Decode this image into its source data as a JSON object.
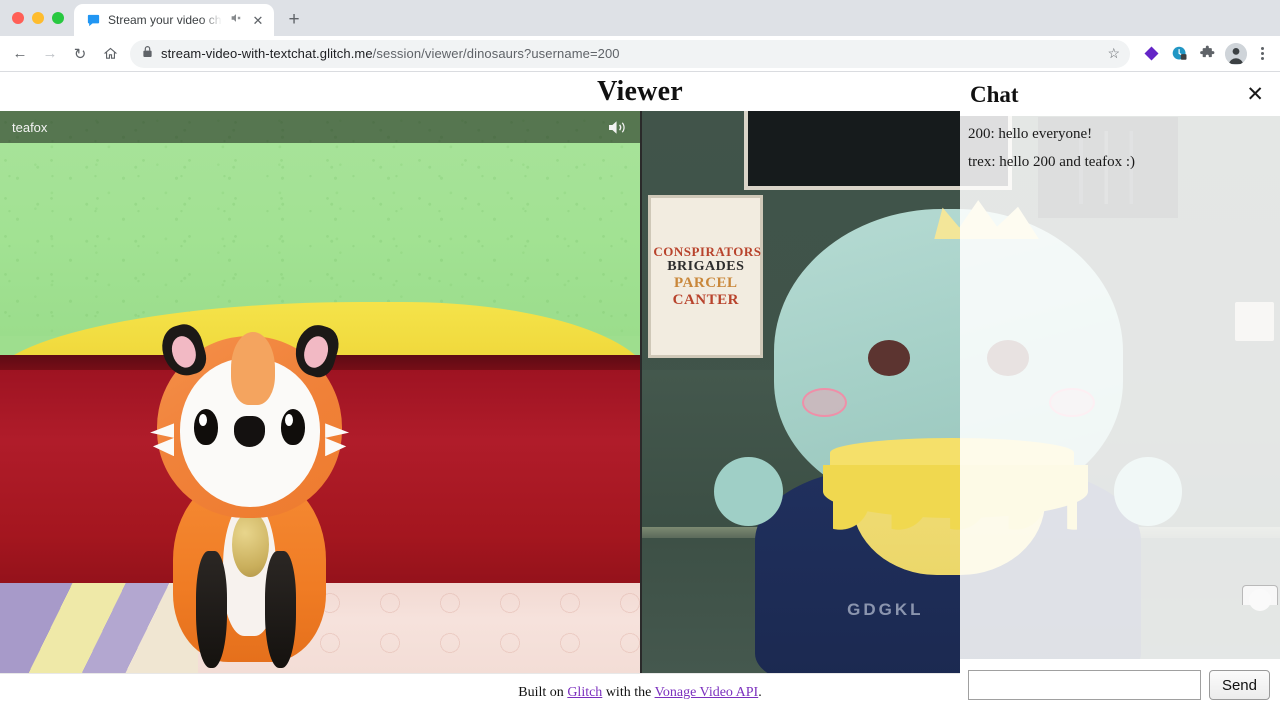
{
  "browser": {
    "tab": {
      "title": "Stream your video chat (en",
      "favicon_name": "glitch-favicon",
      "mute_icon": "speaker-muted-icon",
      "close_label": "✕"
    },
    "new_tab_label": "+",
    "nav": {
      "back_label": "←",
      "forward_label": "→",
      "reload_label": "↻",
      "home_label": "⌂"
    },
    "omnibox": {
      "lock_icon": "lock-icon",
      "host": "stream-video-with-textchat.glitch.me",
      "path": "/session/viewer/dinosaurs?username=200",
      "star_label": "☆"
    },
    "toolbar_icons": [
      {
        "name": "diamond-extension-icon",
        "color": "#6425c7"
      },
      {
        "name": "clock-privacy-icon",
        "color": "#2196c4"
      },
      {
        "name": "puzzle-extensions-icon",
        "color": "#5f6368"
      },
      {
        "name": "profile-avatar-icon",
        "color": "#3c4043"
      }
    ],
    "menu_label": "kebab-menu"
  },
  "page": {
    "title": "Viewer",
    "footer": {
      "prefix": "Built on ",
      "link1": "Glitch",
      "middle": " with the ",
      "link2": "Vonage Video API",
      "suffix": ".",
      "link_color": "#7b2fbe"
    }
  },
  "videos": [
    {
      "stream_name": "teafox",
      "speaker_icon": "speaker-on-icon",
      "poster": null
    },
    {
      "stream_name": "",
      "speaker_icon": "",
      "poster": {
        "line1": "CONSPIRATORS",
        "line2": "BRIGADES",
        "line3": "PARCEL",
        "line4": "CANTER"
      },
      "shirt_text": "GDGKL"
    }
  ],
  "chat": {
    "title": "Chat",
    "close_label": "✕",
    "messages": [
      {
        "text": "200: hello everyone!"
      },
      {
        "text": "trex: hello 200 and teafox :)"
      }
    ],
    "input_value": "",
    "input_placeholder": "",
    "send_label": "Send"
  }
}
